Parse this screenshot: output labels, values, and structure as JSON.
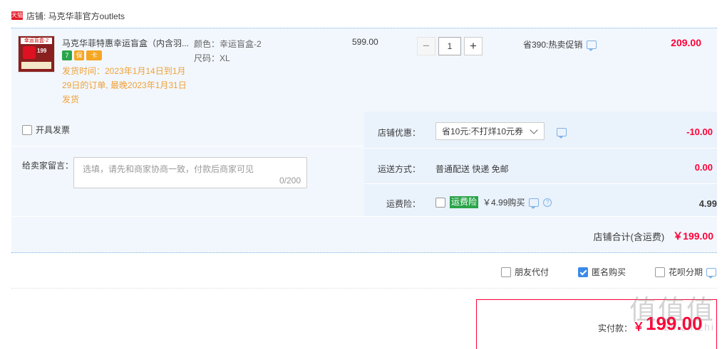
{
  "shop": {
    "badge": "天猫",
    "label": "店铺: 马克华菲官方outlets"
  },
  "item": {
    "thumb_text_top": "幸运盲盒-2",
    "thumb_price": "199",
    "title": "马克华菲特惠幸运盲盒（内含羽...",
    "tags": [
      "7",
      "保",
      "卡"
    ],
    "ship_note": "发货时间：2023年1月14日到1月29日的订单, 最晚2023年1月31日发货",
    "sku_color": "颜色：幸运盲盒-2",
    "sku_size": "尺码：XL",
    "price_orig": "599.00",
    "qty_minus": "−",
    "qty_value": "1",
    "qty_plus": "+",
    "promo": "省390:热卖促销",
    "total": "209.00"
  },
  "invoice": {
    "label": "开具发票"
  },
  "message": {
    "label": "给卖家留言：",
    "placeholder": "选填，请先和商家协商一致，付款后商家可见",
    "count": "0/200"
  },
  "coupon": {
    "label": "店铺优惠：",
    "selected": "省10元:不打烊10元券",
    "amount": "-10.00"
  },
  "shipping": {
    "label": "运送方式：",
    "value": "普通配送 快递 免邮",
    "amount": "0.00"
  },
  "insurance": {
    "label": "运费险：",
    "tag": "运费险",
    "price": "￥4.99购买",
    "amount": "4.99"
  },
  "shop_total": {
    "label": "店铺合计(含运费)",
    "value": "￥199.00"
  },
  "options": {
    "friend_pay": "朋友代付",
    "anonymous": "匿名购买",
    "huabei": "花呗分期"
  },
  "payment": {
    "label": "实付款：",
    "yen": "￥",
    "value": "199.00"
  },
  "watermark": {
    "main": "值值值",
    "sub": "zhizhizhi"
  },
  "colors": {
    "accent_red": "#ff0036",
    "bg_blue": "#f2f7fd",
    "link_blue": "#3c8ae8",
    "note_orange": "#f0a138"
  }
}
